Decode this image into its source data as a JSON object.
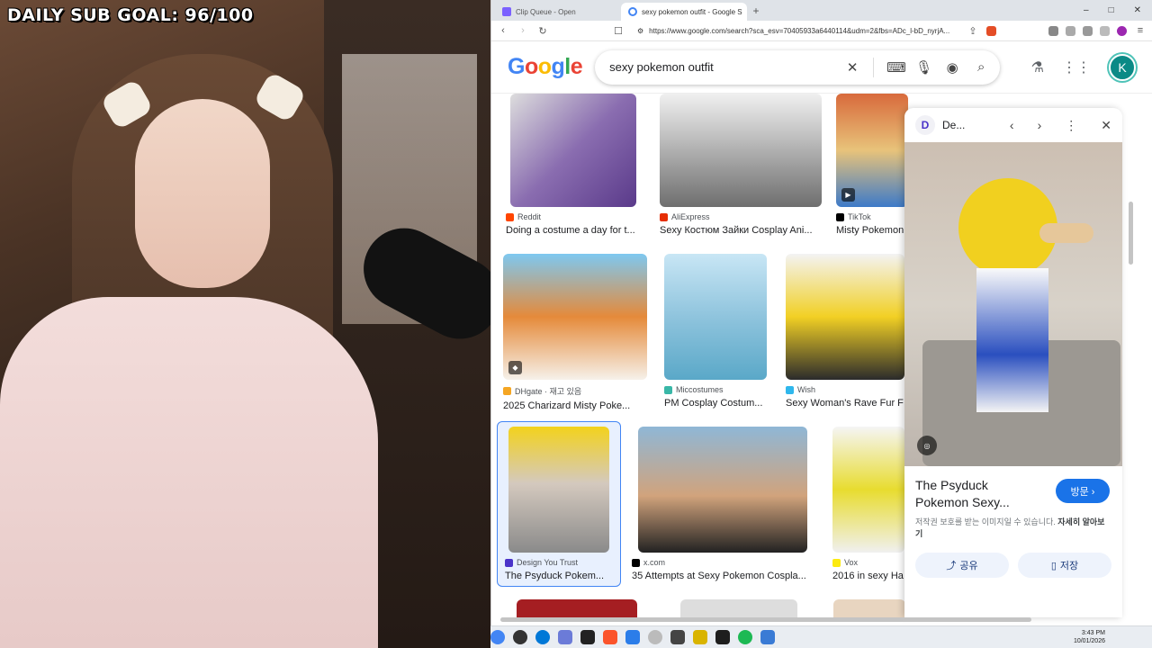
{
  "overlay": {
    "goal_label": "DAILY SUB GOAL:",
    "goal_count": "96/100"
  },
  "browser": {
    "tabs": [
      {
        "label": "Clip Queue - Open",
        "active": false
      },
      {
        "label": "sexy pokemon outfit - Google S",
        "active": true
      }
    ],
    "new_tab": "+",
    "window_controls": [
      "‒",
      "□",
      "✕"
    ],
    "url": "https://www.google.com/search?sca_esv=70405933a6440114&udm=2&fbs=ADc_l-bD_nyrjA..."
  },
  "google": {
    "logo": [
      "G",
      "o",
      "o",
      "g",
      "l",
      "e"
    ],
    "query": "sexy pokemon outfit",
    "avatar_letter": "K"
  },
  "results": [
    {
      "source": "Reddit",
      "title": "Doing a costume a day for t...",
      "fav_color": "#ff4500"
    },
    {
      "source": "AliExpress",
      "title": "Sexy Костюм Зайки Cosplay Ani...",
      "fav_color": "#e62e04"
    },
    {
      "source": "TikTok",
      "title": "Misty Pokemon",
      "fav_color": "#000000"
    },
    {
      "source": "DHgate · 재고 있음",
      "title": "2025 Charizard Misty Poke...",
      "fav_color": "#f5a623"
    },
    {
      "source": "Miccostumes",
      "title": "PM Cosplay Costum...",
      "fav_color": "#39b7a7"
    },
    {
      "source": "Wish",
      "title": "Sexy Woman's Rave Fur F",
      "fav_color": "#2fb7ec"
    },
    {
      "source": "Design You Trust",
      "title": "The Psyduck Pokem...",
      "fav_color": "#4a33c9"
    },
    {
      "source": "x.com",
      "title": "35 Attempts at Sexy Pokemon Cospla...",
      "fav_color": "#000000"
    },
    {
      "source": "Vox",
      "title": "2016 in sexy Ha",
      "fav_color": "#fcea10"
    }
  ],
  "panel": {
    "site": "De...",
    "title": "The Psyduck Pokemon Sexy...",
    "visit_label": "방문 ›",
    "note": "저작권 보호를 받는 이미지일 수 있습니다.",
    "note_more": "자세히 알아보기",
    "share_label": "공유",
    "save_label": "저장"
  },
  "taskbar": {
    "time": "3:43 PM",
    "date": "10/01/2026"
  },
  "colors": {
    "google_blue": "#1a73e8",
    "avatar": "#0b8a86",
    "selected_border": "#4285f4"
  }
}
